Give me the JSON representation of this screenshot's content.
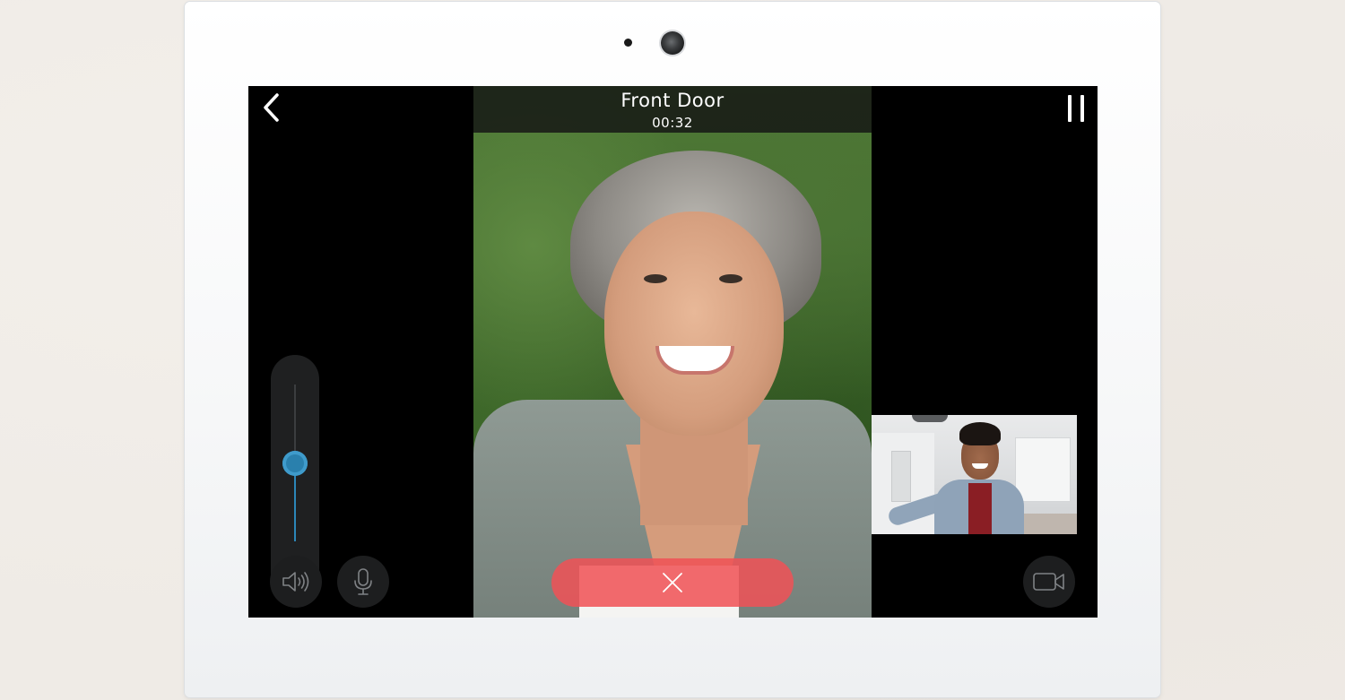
{
  "call": {
    "title": "Front Door",
    "timer": "00:32"
  },
  "controls": {
    "back_icon": "chevron-left-icon",
    "pause_icon": "pause-icon",
    "speaker_icon": "speaker-icon",
    "mic_icon": "microphone-icon",
    "camera_icon": "video-camera-icon",
    "end_call_icon": "close-icon"
  },
  "volume": {
    "level": 0.5
  },
  "colors": {
    "accent": "#2c87b8",
    "end_call": "#f05256",
    "screen_bg": "#000000",
    "control_bg": "#1d1e1f",
    "text": "#ffffff"
  }
}
